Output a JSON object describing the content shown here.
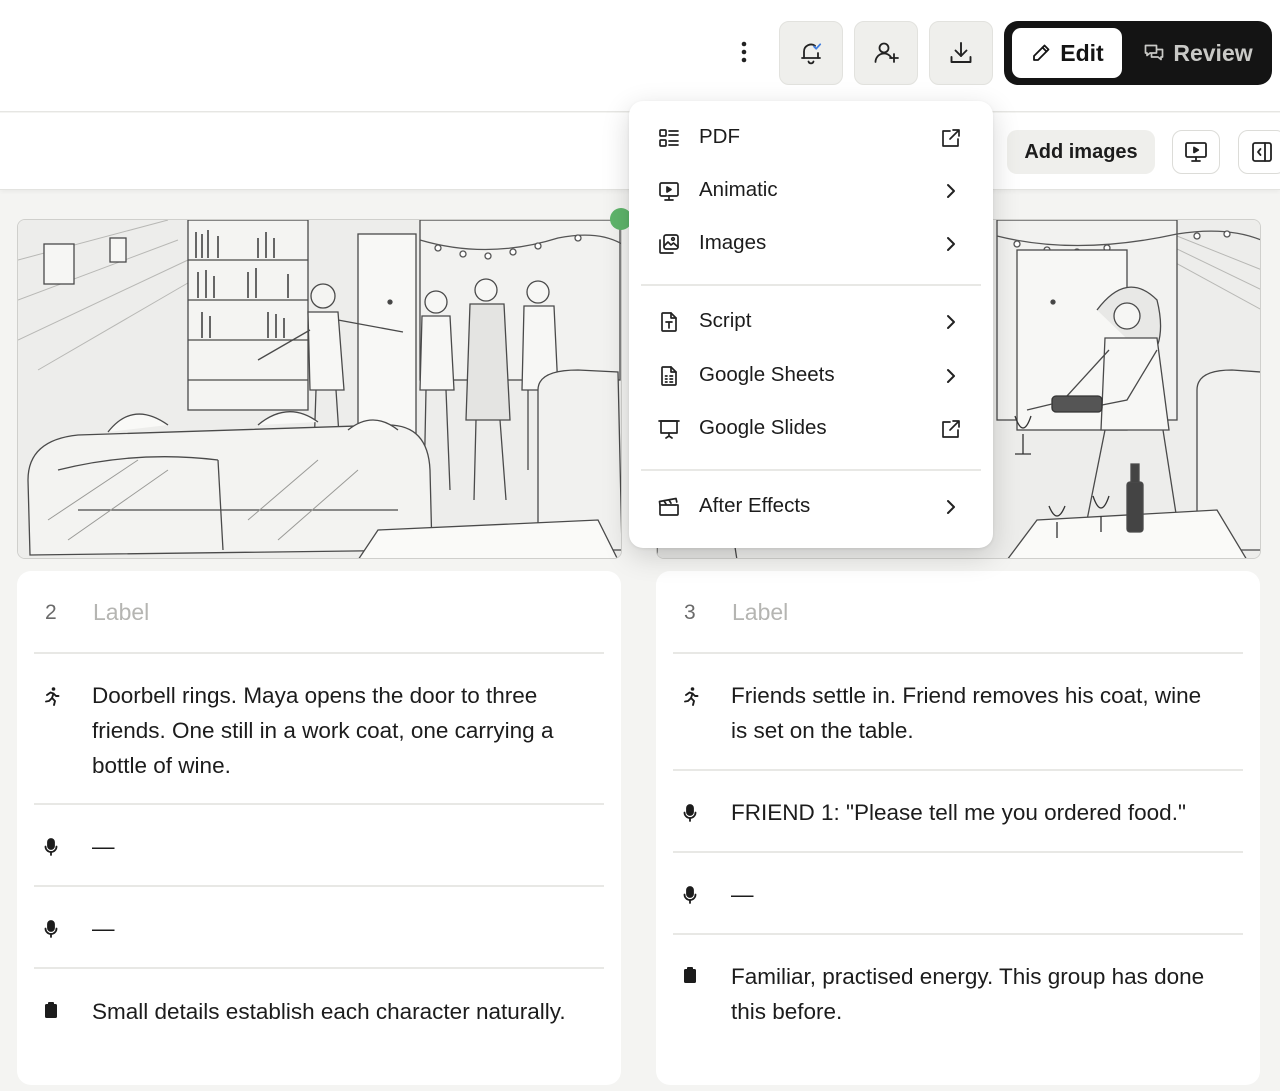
{
  "header": {
    "more_icon": "more-vertical-icon",
    "notify_icon": "bell-check-icon",
    "share_icon": "user-plus-icon",
    "download_icon": "download-icon",
    "mode": {
      "edit_label": "Edit",
      "review_label": "Review",
      "active": "edit"
    }
  },
  "toolbar": {
    "add_images_label": "Add images",
    "present_icon": "presentation-icon",
    "panel_icon": "panel-left-icon"
  },
  "export_menu": {
    "items": [
      {
        "label": "PDF",
        "icon": "pdf-layout-icon",
        "trailing": "external-link-icon"
      },
      {
        "label": "Animatic",
        "icon": "presentation-icon",
        "trailing": "chevron-right-icon"
      },
      {
        "label": "Images",
        "icon": "images-icon",
        "trailing": "chevron-right-icon"
      },
      {
        "label": "Script",
        "icon": "script-file-icon",
        "trailing": "chevron-right-icon"
      },
      {
        "label": "Google Sheets",
        "icon": "sheet-file-icon",
        "trailing": "chevron-right-icon"
      },
      {
        "label": "Google Slides",
        "icon": "slides-icon",
        "trailing": "external-link-icon"
      },
      {
        "label": "After Effects",
        "icon": "clapperboard-icon",
        "trailing": "chevron-right-icon"
      }
    ]
  },
  "frames": [
    {
      "number": "2",
      "label_placeholder": "Label",
      "action": "Doorbell rings. Maya opens the door to three friends. One still in a work coat, one carrying a bottle of wine.",
      "dialogue_1": "—",
      "dialogue_2": "—",
      "notes": "Small details establish each character naturally."
    },
    {
      "number": "3",
      "label_placeholder": "Label",
      "action": "Friends settle in. Friend removes his coat, wine is set on the table.",
      "dialogue_1": "FRIEND 1: \"Please tell me you ordered food.\"",
      "dialogue_2": "—",
      "notes": "Familiar, practised energy. This group has done this before."
    }
  ],
  "colors": {
    "accent_dark": "#141414",
    "status_dot": "#5fb56b",
    "bell_check": "#3f7de0",
    "page_bg": "#f4f4f2"
  }
}
